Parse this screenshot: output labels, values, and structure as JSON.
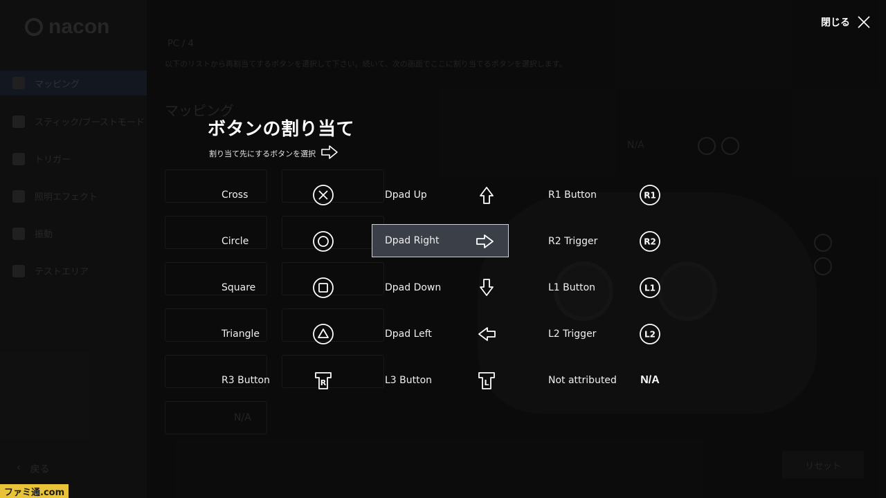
{
  "app": {
    "logo_text": "nacon",
    "profile_name": "PC / 4",
    "description": "以下のリストから再割当てするボタンを選択して下さい。続いて、次の画面でここに割り当てるボタンを選択します。",
    "section_title": "マッピング",
    "back_label": "戻る",
    "reset_label": "リセット",
    "na_text": "N/A",
    "sidebar": [
      {
        "label": "マッピング"
      },
      {
        "label": "スティック/ブーストモード"
      },
      {
        "label": "トリガー"
      },
      {
        "label": "照明エフェクト"
      },
      {
        "label": "振動"
      },
      {
        "label": "テストエリア"
      }
    ]
  },
  "modal": {
    "close_label": "閉じる",
    "title": "ボタンの割り当て",
    "subtitle": "割り当て先にするボタンを選択",
    "columns": [
      [
        {
          "label": "Cross",
          "icon": "cross-icon"
        },
        {
          "label": "Circle",
          "icon": "circle-icon"
        },
        {
          "label": "Square",
          "icon": "square-icon"
        },
        {
          "label": "Triangle",
          "icon": "triangle-icon"
        },
        {
          "label": "R3 Button",
          "icon": "r3-icon",
          "glyph": "R"
        }
      ],
      [
        {
          "label": "Dpad Up",
          "icon": "arrow-up-icon"
        },
        {
          "label": "Dpad Right",
          "icon": "arrow-right-icon",
          "selected": true
        },
        {
          "label": "Dpad Down",
          "icon": "arrow-down-icon"
        },
        {
          "label": "Dpad Left",
          "icon": "arrow-left-icon"
        },
        {
          "label": "L3 Button",
          "icon": "l3-icon",
          "glyph": "L"
        }
      ],
      [
        {
          "label": "R1 Button",
          "icon": "r1-icon",
          "glyph": "R1"
        },
        {
          "label": "R2 Trigger",
          "icon": "r2-icon",
          "glyph": "R2"
        },
        {
          "label": "L1 Button",
          "icon": "l1-icon",
          "glyph": "L1"
        },
        {
          "label": "L2 Trigger",
          "icon": "l2-icon",
          "glyph": "L2"
        },
        {
          "label": "Not attributed",
          "icon": "na-text",
          "text": "N/A"
        }
      ]
    ]
  },
  "watermark": "ファミ通.com",
  "colors": {
    "background": "#0b0b0b",
    "selected_bg": "#3b3f48",
    "selected_border": "#cfd2d8",
    "text": "#ffffff",
    "watermark_bg": "#e8c33a"
  }
}
